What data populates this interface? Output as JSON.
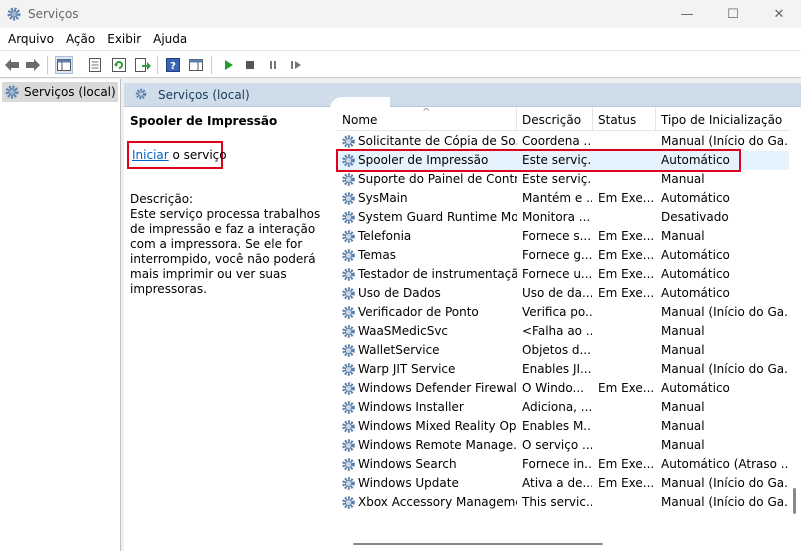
{
  "window": {
    "title": "Serviços",
    "app_icon": "gear-icon",
    "buttons": {
      "minimize": "—",
      "maximize": "☐",
      "close": "✕"
    }
  },
  "menu": [
    "Arquivo",
    "Ação",
    "Exibir",
    "Ajuda"
  ],
  "toolbar": {
    "icons": [
      "back-arrow-icon",
      "forward-arrow-icon",
      "console-tree-icon",
      "properties-icon",
      "refresh-icon",
      "export-list-icon",
      "help-icon",
      "action-pane-icon",
      "start-service-icon",
      "stop-service-icon",
      "pause-service-icon",
      "restart-service-icon"
    ]
  },
  "tree": {
    "selected_label": "Serviços (local)"
  },
  "content": {
    "header_title": "Serviços (local)",
    "selected_service": "Spooler de Impressão",
    "action": {
      "link": "Iniciar",
      "suffix": " o serviço"
    },
    "description_label": "Descrição:",
    "description_text": "Este serviço processa trabalhos de impressão e faz a interação com a impressora. Se ele for interrompido, você não poderá mais imprimir ou ver suas impressoras."
  },
  "table": {
    "columns": {
      "name": "Nome",
      "desc": "Descrição",
      "status": "Status",
      "start": "Tipo de Inicialização"
    },
    "sort_indicator": "^",
    "rows": [
      {
        "name": "Solicitante de Cópia de So...",
        "desc": "Coordena ...",
        "status": "",
        "start": "Manual (Início do Ga..."
      },
      {
        "name": "Spooler de Impressão",
        "desc": "Este serviç...",
        "status": "",
        "start": "Automático"
      },
      {
        "name": "Suporte do Painel de Contr...",
        "desc": "Este serviç...",
        "status": "",
        "start": "Manual"
      },
      {
        "name": "SysMain",
        "desc": "Mantém e ...",
        "status": "Em Exe...",
        "start": "Automático"
      },
      {
        "name": "System Guard Runtime Mo...",
        "desc": "Monitora ...",
        "status": "",
        "start": "Desativado"
      },
      {
        "name": "Telefonia",
        "desc": "Fornece s...",
        "status": "Em Exe...",
        "start": "Manual"
      },
      {
        "name": "Temas",
        "desc": "Fornece g...",
        "status": "Em Exe...",
        "start": "Automático"
      },
      {
        "name": "Testador de instrumentação...",
        "desc": "Fornece u...",
        "status": "Em Exe...",
        "start": "Automático"
      },
      {
        "name": "Uso de Dados",
        "desc": "Uso de da...",
        "status": "Em Exe...",
        "start": "Automático"
      },
      {
        "name": "Verificador de Ponto",
        "desc": "Verifica po...",
        "status": "",
        "start": "Manual (Início do Ga..."
      },
      {
        "name": "WaaSMedicSvc",
        "desc": "<Falha ao ...",
        "status": "",
        "start": "Manual"
      },
      {
        "name": "WalletService",
        "desc": "Objetos d...",
        "status": "",
        "start": "Manual"
      },
      {
        "name": "Warp JIT Service",
        "desc": "Enables JI...",
        "status": "",
        "start": "Manual (Início do Ga..."
      },
      {
        "name": "Windows Defender Firewall",
        "desc": "O Windo...",
        "status": "Em Exe...",
        "start": "Automático"
      },
      {
        "name": "Windows Installer",
        "desc": "Adiciona, ...",
        "status": "",
        "start": "Manual"
      },
      {
        "name": "Windows Mixed Reality Op...",
        "desc": "Enables M...",
        "status": "",
        "start": "Manual"
      },
      {
        "name": "Windows Remote Manage...",
        "desc": "O serviço ...",
        "status": "",
        "start": "Manual"
      },
      {
        "name": "Windows Search",
        "desc": "Fornece in...",
        "status": "Em Exe...",
        "start": "Automático (Atraso ..."
      },
      {
        "name": "Windows Update",
        "desc": "Ativa a de...",
        "status": "Em Exe...",
        "start": "Manual (Início do Ga..."
      },
      {
        "name": "Xbox Accessory Manageme...",
        "desc": "This servic...",
        "status": "",
        "start": "Manual (Início do Ga..."
      }
    ]
  }
}
